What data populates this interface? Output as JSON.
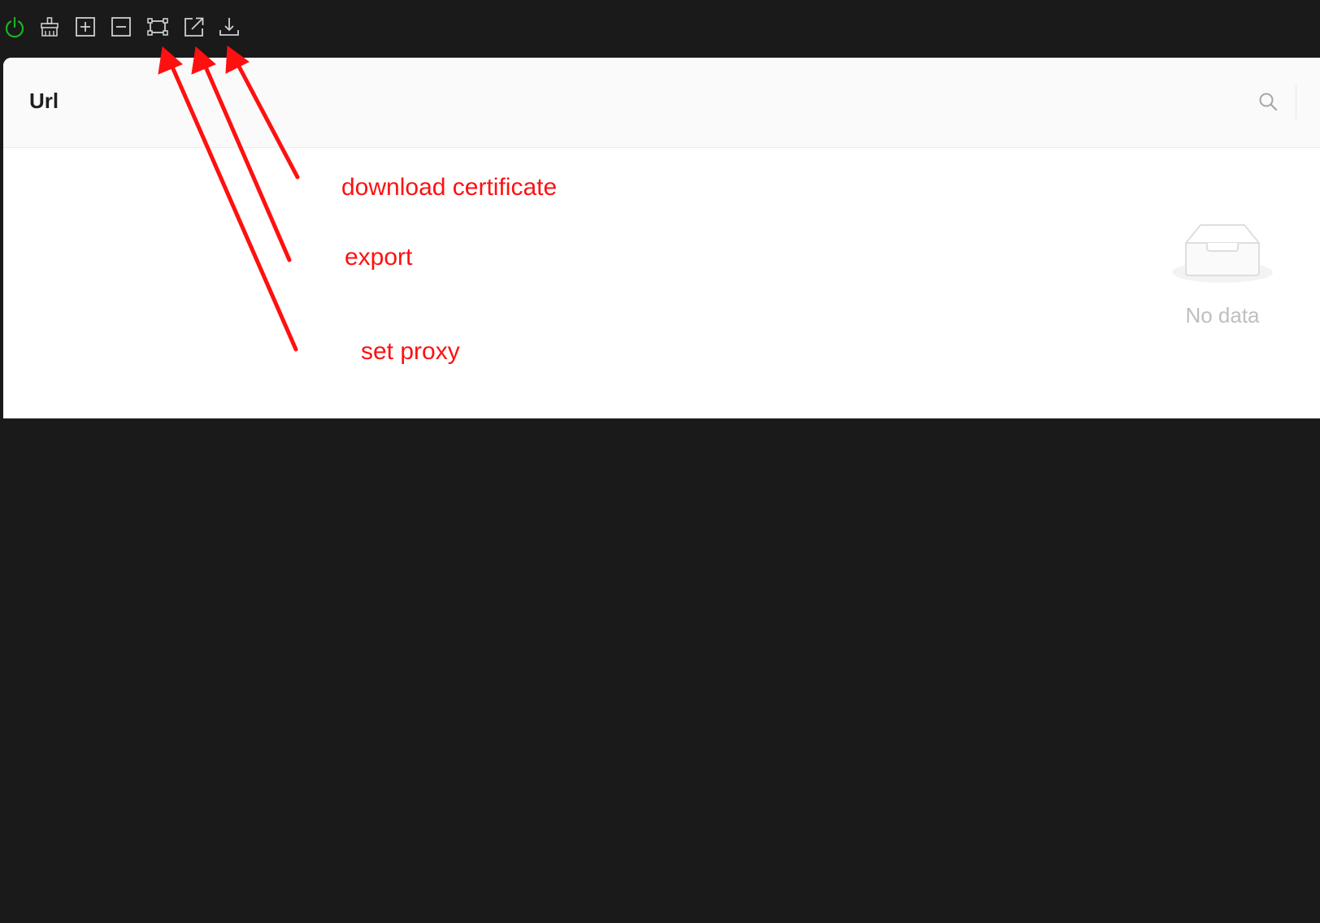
{
  "toolbar": {
    "buttons": [
      {
        "icon": "power-icon",
        "color": "#1bb321"
      },
      {
        "icon": "broom-clear-icon",
        "color": "#cfcfcf"
      },
      {
        "icon": "plus-square-icon",
        "color": "#cfcfcf"
      },
      {
        "icon": "minus-square-icon",
        "color": "#cfcfcf"
      },
      {
        "icon": "proxy-frame-icon",
        "color": "#cfcfcf"
      },
      {
        "icon": "export-icon",
        "color": "#cfcfcf"
      },
      {
        "icon": "download-icon",
        "color": "#cfcfcf"
      }
    ]
  },
  "table": {
    "column_title": "Url",
    "search_icon": "search-icon",
    "empty_icon": "empty-inbox-icon",
    "empty_text": "No data"
  },
  "annotations": {
    "color": "#ff1010",
    "download_certificate": "download certificate",
    "export": "export",
    "set_proxy": "set proxy"
  }
}
